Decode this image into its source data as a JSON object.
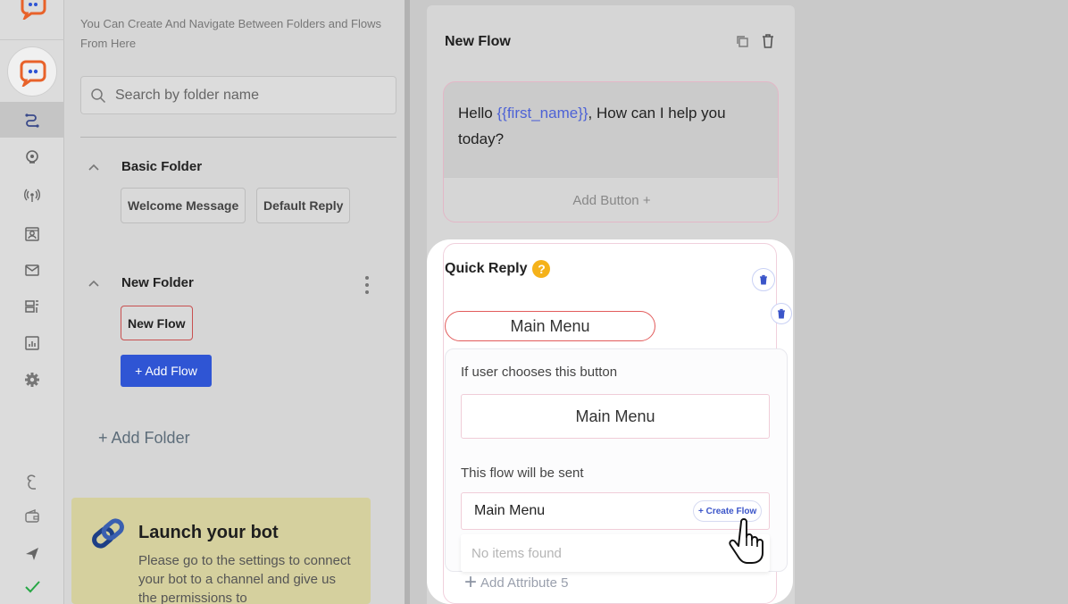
{
  "sidebar": {
    "nav_icons": [
      "flows-icon",
      "ai-icon",
      "broadcast-icon",
      "contacts-icon",
      "mail-icon",
      "templates-icon",
      "analytics-icon",
      "settings-icon"
    ],
    "bottom_icons": [
      "language-icon",
      "wallet-icon",
      "send-icon",
      "check-icon"
    ]
  },
  "folders_panel": {
    "hint": "You Can Create And Navigate Between Folders and Flows From Here",
    "search_placeholder": "Search by folder name",
    "folders": [
      {
        "name": "Basic Folder",
        "flows": [
          "Welcome Message",
          "Default Reply"
        ]
      },
      {
        "name": "New Folder",
        "flows": [
          "New Flow"
        ]
      }
    ],
    "add_flow_label": "+ Add Flow",
    "add_folder_label": "+ Add Folder",
    "launch": {
      "title": "Launch your bot",
      "body": "Please go to the settings to connect your bot to a channel and give us the permissions to"
    }
  },
  "flow": {
    "title": "New Flow",
    "message": {
      "prefix": "Hello ",
      "variable": "{{first_name}}",
      "suffix": ", How can I help you today?"
    },
    "add_button_label": "Add Button +",
    "quick_reply": {
      "title": "Quick Reply",
      "help_glyph": "?",
      "button_label": "Main Menu",
      "choose_label": "If user chooses this button",
      "choose_value": "Main Menu",
      "sent_label": "This flow will be sent",
      "sent_value": "Main Menu",
      "create_flow_label": "+ Create Flow",
      "empty_label": "No items found",
      "add_attribute_label": "Add Attribute 5"
    }
  },
  "colors": {
    "brand": "#e8622a",
    "accent_blue": "#2f55d4",
    "variable": "#4d62d6",
    "selected_border": "#c85050"
  }
}
